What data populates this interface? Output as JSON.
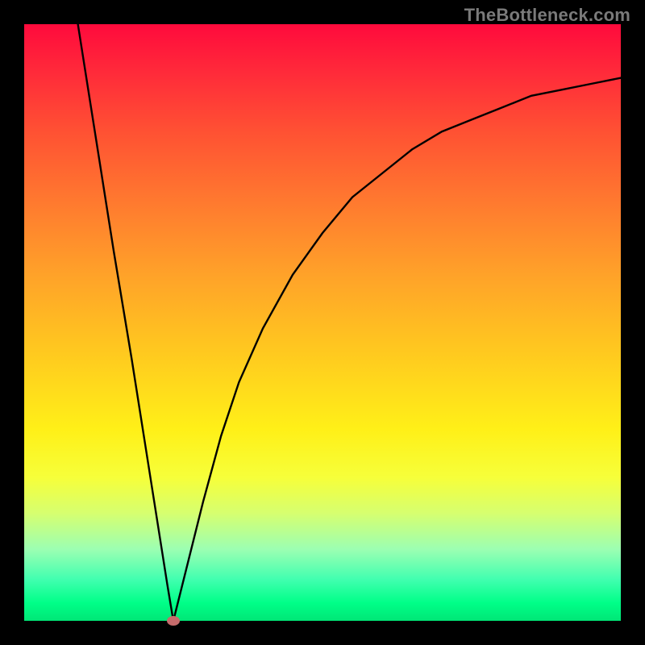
{
  "watermark": "TheBottleneck.com",
  "chart_data": {
    "type": "line",
    "title": "",
    "xlabel": "",
    "ylabel": "",
    "xlim": [
      0,
      100
    ],
    "ylim": [
      0,
      100
    ],
    "grid": false,
    "series": [
      {
        "name": "curve",
        "x": [
          9,
          12,
          15,
          18,
          21,
          24,
          25,
          27,
          30,
          33,
          36,
          40,
          45,
          50,
          55,
          60,
          65,
          70,
          75,
          80,
          85,
          90,
          95,
          100
        ],
        "y": [
          100,
          81,
          62,
          44,
          25,
          6,
          0,
          8,
          20,
          31,
          40,
          49,
          58,
          65,
          71,
          75,
          79,
          82,
          84,
          86,
          88,
          89,
          90,
          91
        ]
      }
    ],
    "annotations": [
      {
        "type": "marker",
        "x": 25,
        "y": 0,
        "shape": "ellipse",
        "color": "#c56b6b"
      }
    ]
  },
  "colors": {
    "gradient_top": "#ff0a3c",
    "gradient_bottom": "#00e676",
    "line": "#000000",
    "marker": "#c56b6b",
    "frame": "#000000"
  }
}
